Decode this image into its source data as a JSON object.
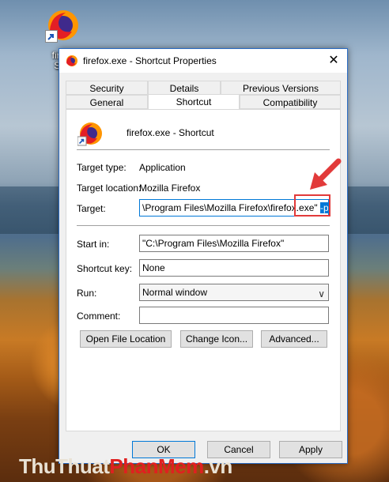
{
  "desktop": {
    "icon_label_line1": "firefo",
    "icon_label_line2": "Sho"
  },
  "window": {
    "title": "firefox.exe - Shortcut Properties",
    "close": "✕"
  },
  "tabs": {
    "row1": [
      "Security",
      "Details",
      "Previous Versions"
    ],
    "row2": [
      "General",
      "Shortcut",
      "Compatibility"
    ],
    "active": "Shortcut"
  },
  "shortcut": {
    "name": "firefox.exe - Shortcut",
    "target_type_label": "Target type:",
    "target_type": "Application",
    "target_location_label": "Target location:",
    "target_location": "Mozilla Firefox",
    "target_label": "Target:",
    "target_value": "\\Program Files\\Mozilla Firefox\\firefox.exe\" ",
    "target_selected": "-private",
    "start_in_label": "Start in:",
    "start_in": "\"C:\\Program Files\\Mozilla Firefox\"",
    "shortcut_key_label": "Shortcut key:",
    "shortcut_key": "None",
    "run_label": "Run:",
    "run_value": "Normal window",
    "comment_label": "Comment:",
    "comment_value": ""
  },
  "buttons": {
    "open_file_location": "Open File Location",
    "change_icon": "Change Icon...",
    "advanced": "Advanced...",
    "ok": "OK",
    "cancel": "Cancel",
    "apply": "Apply"
  },
  "watermark": {
    "part1": "ThuThuat",
    "part2": "PhanMem",
    "part3": ".vn"
  },
  "colors": {
    "accent": "#0078d7",
    "highlight_box": "#e23a3a",
    "arrow": "#e23a3a"
  }
}
